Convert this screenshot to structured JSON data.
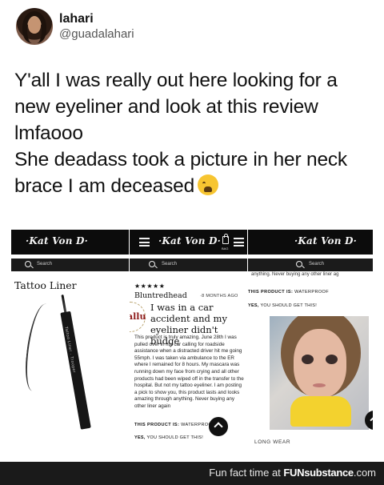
{
  "tweet": {
    "name": "lahari",
    "handle": "@guadalahari",
    "lines": [
      "Y'all I was really out here looking for a",
      "new eyeliner and look at this review",
      "lmfaooo",
      "She deadass took a picture in her neck",
      "brace I am deceased"
    ],
    "emoji": "weary-face-emoji"
  },
  "collage": {
    "logo": "·Kat Von D·",
    "search_placeholder": "Search",
    "bag_label": "BAG",
    "panel1": {
      "title": "Tattoo Liner",
      "pen_text": "Tattoo Liner · Trooper"
    },
    "panel2": {
      "stars": "★★★★★",
      "reviewer": "Bluntredhead",
      "time": "·8 MONTHS AGO",
      "badge": "allu",
      "headline": "I was in a car accident and my eyeliner didn't budge",
      "body": "This product is truly amazing. June 28th I was pulled over in my car calling for roadside assistance when a distracted driver hit me going 55mph. I was taken via ambulance to the ER where I remained for 8 hours. My mascara was running down my face from crying and all other products had been wiped off in the transfer to the hospital. But not my tattoo eyeliner. I am posting a pick to show you, this product lasts and looks amazing through anything. Never buying any other liner again",
      "product_label": "THIS PRODUCT IS:",
      "product_value": "WATERPROOF",
      "yes_label": "YES,",
      "yes_value": "YOU SHOULD GET THIS!"
    },
    "panel3": {
      "cut_text": "anything. Never buying any other liner ag",
      "product_label": "THIS PRODUCT IS:",
      "product_value": "WATERPROOF",
      "yes_label": "YES,",
      "yes_value": "YOU SHOULD GET THIS!",
      "caption": "LONG WEAR"
    }
  },
  "footer": {
    "prefix": "Fun fact time at ",
    "brand": "FUNsubstance",
    "suffix": ".com"
  }
}
